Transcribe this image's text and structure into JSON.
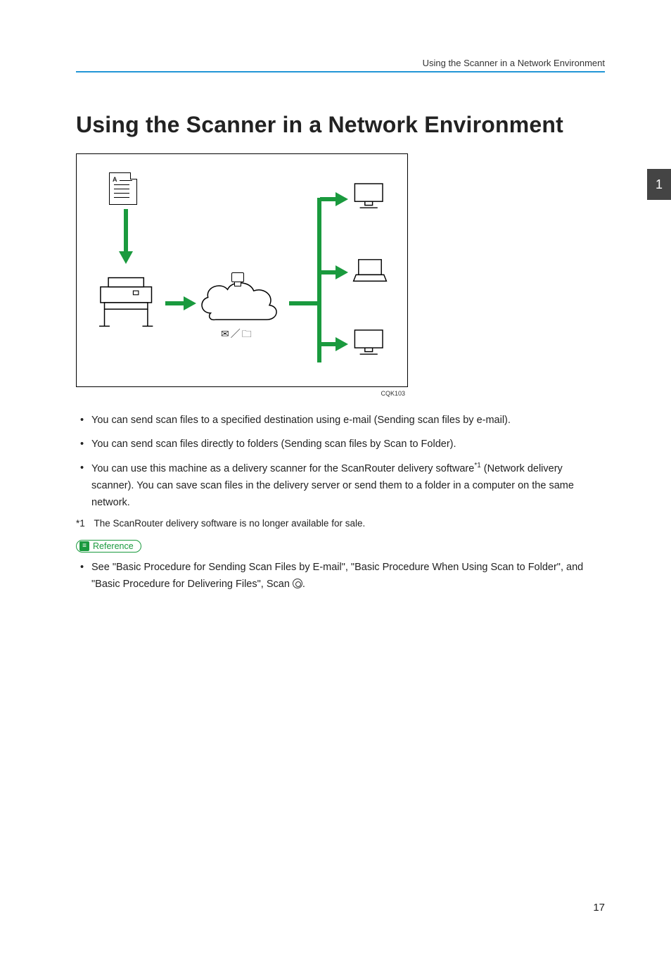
{
  "running_head": "Using the Scanner in a Network Environment",
  "chapter_tab": "1",
  "title": "Using the Scanner in a Network Environment",
  "diagram": {
    "doc_label": "A",
    "code": "CQK103",
    "symbols_label": "✉ ／ 📁",
    "icons": {
      "document": "document-icon",
      "mfp": "printer-icon",
      "cloud": "network-cloud-icon",
      "server": "server-icon",
      "desktop": "desktop-icon",
      "laptop": "laptop-icon"
    }
  },
  "bullets": [
    "You can send scan files to a specified destination using e-mail (Sending scan files by e-mail).",
    "You can send scan files directly to folders (Sending scan files by Scan to Folder).",
    "You can use this machine as a delivery scanner for the ScanRouter delivery software*1 (Network delivery scanner). You can save scan files in the delivery server or send them to a folder in a computer on the same network."
  ],
  "footnote": {
    "mark": "*1",
    "text": "The ScanRouter delivery software is no longer available for sale."
  },
  "reference": {
    "label": "Reference",
    "items": [
      "See \"Basic Procedure for Sending Scan Files by E-mail\", \"Basic Procedure When Using Scan to Folder\", and \"Basic Procedure for Delivering Files\", Scan"
    ],
    "trailing": "."
  },
  "page_number": "17"
}
